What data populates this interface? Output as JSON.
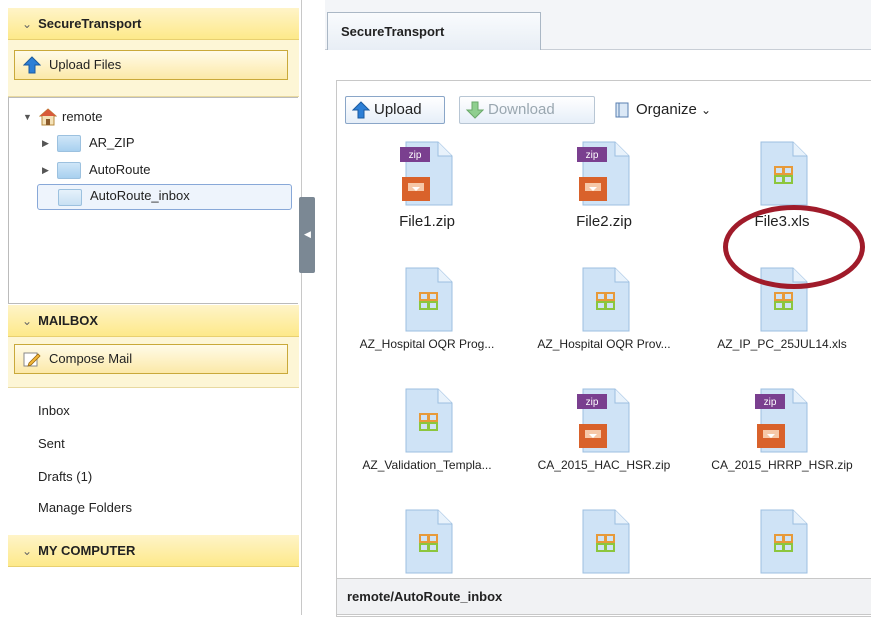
{
  "left_panel": {
    "secure_transport": {
      "title": "SecureTransport",
      "upload_button": "Upload Files",
      "tree": {
        "root": "remote",
        "folders": [
          "AR_ZIP",
          "AutoRoute",
          "AutoRoute_inbox"
        ],
        "selected": "AutoRoute_inbox"
      }
    },
    "mailbox": {
      "title": "MAILBOX",
      "compose_button": "Compose Mail",
      "items": [
        "Inbox",
        "Sent",
        "Drafts (1)",
        "Manage Folders"
      ]
    },
    "my_computer": {
      "title": "MY COMPUTER"
    }
  },
  "right_panel": {
    "tab": "SecureTransport",
    "toolbar": {
      "upload": "Upload",
      "download": "Download",
      "organize": "Organize"
    },
    "files": [
      {
        "name": "File1.zip",
        "type": "zip"
      },
      {
        "name": "File2.zip",
        "type": "zip"
      },
      {
        "name": "File3.xls",
        "type": "xls"
      },
      {
        "name": "AZ_Hospital OQR Prog...",
        "type": "xls"
      },
      {
        "name": "AZ_Hospital OQR Prov...",
        "type": "xls"
      },
      {
        "name": "AZ_IP_PC_25JUL14.xls",
        "type": "xls"
      },
      {
        "name": "AZ_Validation_Templa...",
        "type": "xls"
      },
      {
        "name": "CA_2015_HAC_HSR.zip",
        "type": "zip"
      },
      {
        "name": "CA_2015_HRRP_HSR.zip",
        "type": "zip"
      },
      {
        "name": "",
        "type": "xls"
      },
      {
        "name": "",
        "type": "xls"
      },
      {
        "name": "",
        "type": "xls"
      }
    ],
    "zip_badge": "zip",
    "status_path": "remote/AutoRoute_inbox"
  },
  "colors": {
    "section_header": "#fde98a",
    "highlight_circle": "#a01b2a",
    "zip_purple": "#7a3f8f",
    "zip_orange": "#d9622b"
  }
}
